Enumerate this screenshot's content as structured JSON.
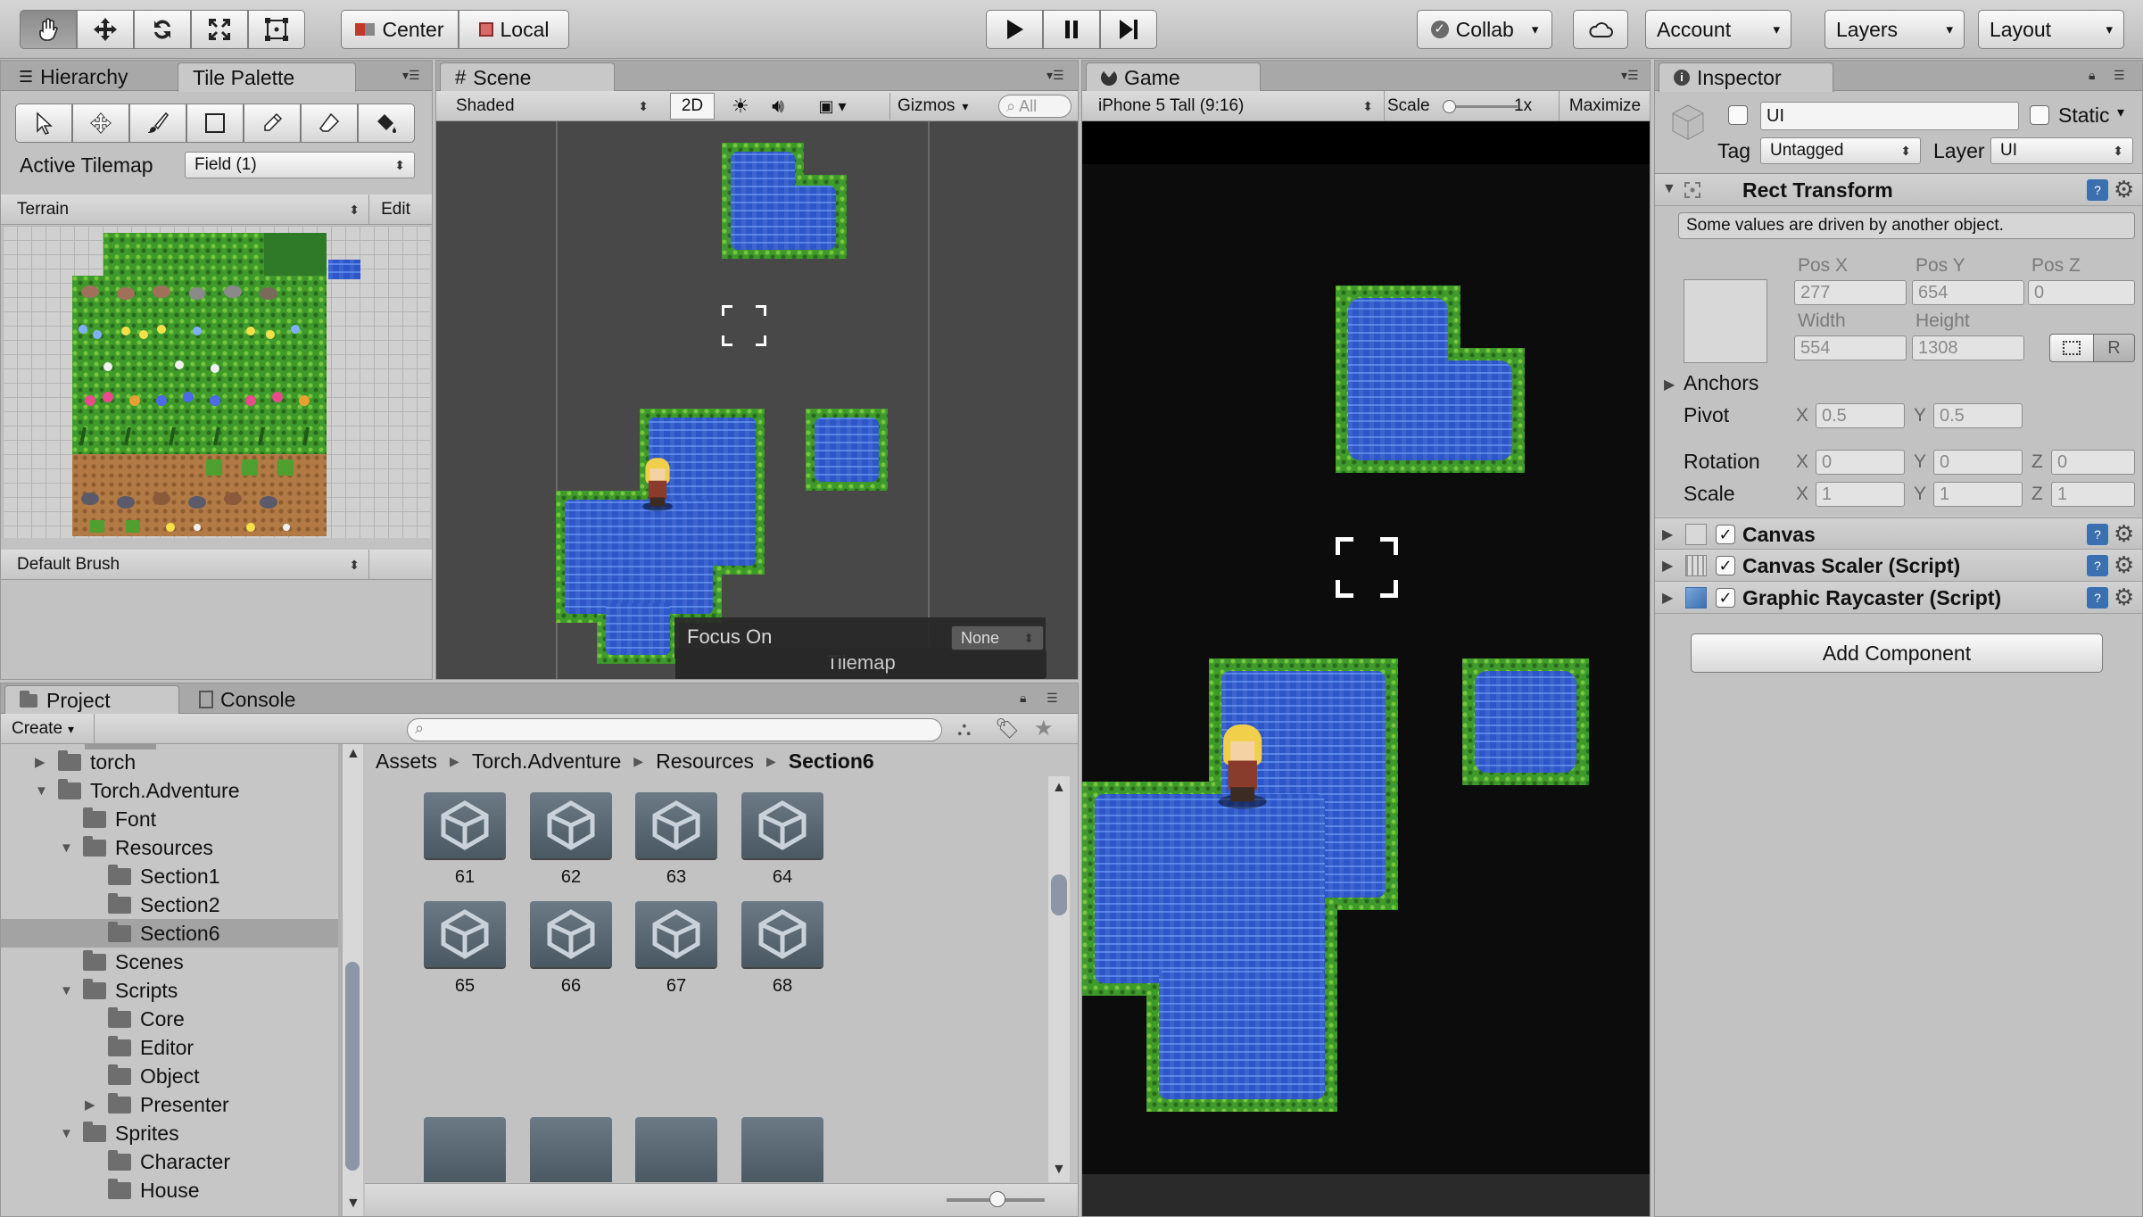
{
  "toolbar": {
    "pivot_center": "Center",
    "pivot_local": "Local",
    "collab": "Collab",
    "account": "Account",
    "layers": "Layers",
    "layout": "Layout"
  },
  "hierarchy_tab": "Hierarchy",
  "tile_palette": {
    "tab": "Tile Palette",
    "active_tilemap_label": "Active Tilemap",
    "active_tilemap_value": "Field (1)",
    "palette": "Terrain",
    "edit": "Edit",
    "brush": "Default Brush"
  },
  "scene": {
    "tab": "Scene",
    "shading": "Shaded",
    "mode_2d": "2D",
    "gizmos": "Gizmos",
    "search_placeholder": "All",
    "overlay_title": "Tilemap",
    "focus_on_label": "Focus On",
    "focus_on_value": "None"
  },
  "game": {
    "tab": "Game",
    "resolution": "iPhone 5 Tall (9:16)",
    "scale_label": "Scale",
    "scale_value": "1x",
    "maximize": "Maximize"
  },
  "inspector": {
    "tab": "Inspector",
    "object_name": "UI",
    "static_label": "Static",
    "tag_label": "Tag",
    "tag_value": "Untagged",
    "layer_label": "Layer",
    "layer_value": "UI",
    "rect_transform": {
      "title": "Rect Transform",
      "notice": "Some values are driven by another object.",
      "pos_x_label": "Pos X",
      "pos_y_label": "Pos Y",
      "pos_z_label": "Pos Z",
      "pos_x": "277",
      "pos_y": "654",
      "pos_z": "0",
      "width_label": "Width",
      "height_label": "Height",
      "width": "554",
      "height": "1308",
      "r_button": "R",
      "anchors_label": "Anchors",
      "pivot_label": "Pivot",
      "pivot_x": "0.5",
      "pivot_y": "0.5",
      "rotation_label": "Rotation",
      "rotation_x": "0",
      "rotation_y": "0",
      "rotation_z": "0",
      "scale_label": "Scale",
      "scale_x": "1",
      "scale_y": "1",
      "scale_z": "1",
      "axis_x": "X",
      "axis_y": "Y",
      "axis_z": "Z"
    },
    "components": [
      {
        "name": "Canvas"
      },
      {
        "name": "Canvas Scaler (Script)"
      },
      {
        "name": "Graphic Raycaster (Script)"
      }
    ],
    "add_component": "Add Component"
  },
  "project": {
    "tab": "Project",
    "console_tab": "Console",
    "create": "Create",
    "tree": [
      {
        "label": "torch",
        "depth": 1,
        "state": "collapsed"
      },
      {
        "label": "Torch.Adventure",
        "depth": 1,
        "state": "expanded"
      },
      {
        "label": "Font",
        "depth": 2,
        "state": "none"
      },
      {
        "label": "Resources",
        "depth": 2,
        "state": "expanded"
      },
      {
        "label": "Section1",
        "depth": 3,
        "state": "none"
      },
      {
        "label": "Section2",
        "depth": 3,
        "state": "none"
      },
      {
        "label": "Section6",
        "depth": 3,
        "state": "none",
        "selected": true
      },
      {
        "label": "Scenes",
        "depth": 2,
        "state": "none"
      },
      {
        "label": "Scripts",
        "depth": 2,
        "state": "expanded"
      },
      {
        "label": "Core",
        "depth": 3,
        "state": "none"
      },
      {
        "label": "Editor",
        "depth": 3,
        "state": "none"
      },
      {
        "label": "Object",
        "depth": 3,
        "state": "none"
      },
      {
        "label": "Presenter",
        "depth": 3,
        "state": "collapsed"
      },
      {
        "label": "Sprites",
        "depth": 2,
        "state": "expanded"
      },
      {
        "label": "Character",
        "depth": 3,
        "state": "none"
      },
      {
        "label": "House",
        "depth": 3,
        "state": "none"
      }
    ],
    "breadcrumb": [
      "Assets",
      "Torch.Adventure",
      "Resources",
      "Section6"
    ],
    "assets": [
      "61",
      "62",
      "63",
      "64",
      "65",
      "66",
      "67",
      "68"
    ]
  }
}
